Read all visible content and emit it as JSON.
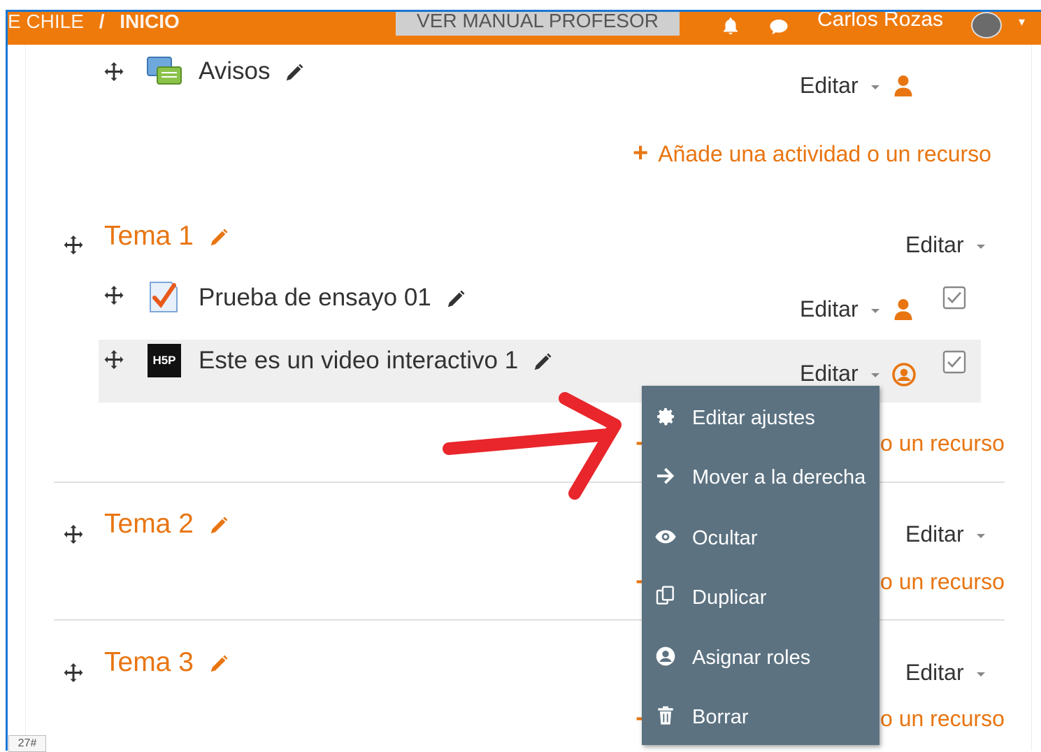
{
  "navbar": {
    "breadcrumb_site": "E CHILE",
    "breadcrumb_sep": "/",
    "breadcrumb_current": "INICIO",
    "manual_button": "VER MANUAL PROFESOR",
    "user_name": "Carlos Rozas",
    "bell_icon": "bell-icon",
    "chat_icon": "chat-icon",
    "brand_color": "#ef7a0c"
  },
  "activities": {
    "avisos": {
      "title": "Avisos",
      "edit_label": "Editar",
      "icon": "forum-icon"
    },
    "add_resource_label": "Añade una actividad o un recurso",
    "add_resource_partial": "o un recurso"
  },
  "sections": [
    {
      "title": "Tema 1",
      "edit_label": "Editar"
    },
    {
      "title": "Tema 2",
      "edit_label": "Editar"
    },
    {
      "title": "Tema 3",
      "edit_label": "Editar"
    }
  ],
  "tema1_items": [
    {
      "title": "Prueba de ensayo 01",
      "edit_label": "Editar",
      "icon": "quiz-icon"
    },
    {
      "title": "Este es un video interactivo 1",
      "edit_label": "Editar",
      "icon": "h5p-icon",
      "icon_text": "H5P"
    }
  ],
  "dropdown": {
    "items": [
      {
        "label": "Editar ajustes",
        "icon": "gear-icon"
      },
      {
        "label": "Mover a la derecha",
        "icon": "arrow-right-icon"
      },
      {
        "label": "Ocultar",
        "icon": "eye-icon"
      },
      {
        "label": "Duplicar",
        "icon": "copy-icon"
      },
      {
        "label": "Asignar roles",
        "icon": "user-circle-icon"
      },
      {
        "label": "Borrar",
        "icon": "trash-icon"
      }
    ],
    "background": "#5c7281"
  },
  "footer": {
    "badge": "27#"
  },
  "accent_color": "#e87511"
}
